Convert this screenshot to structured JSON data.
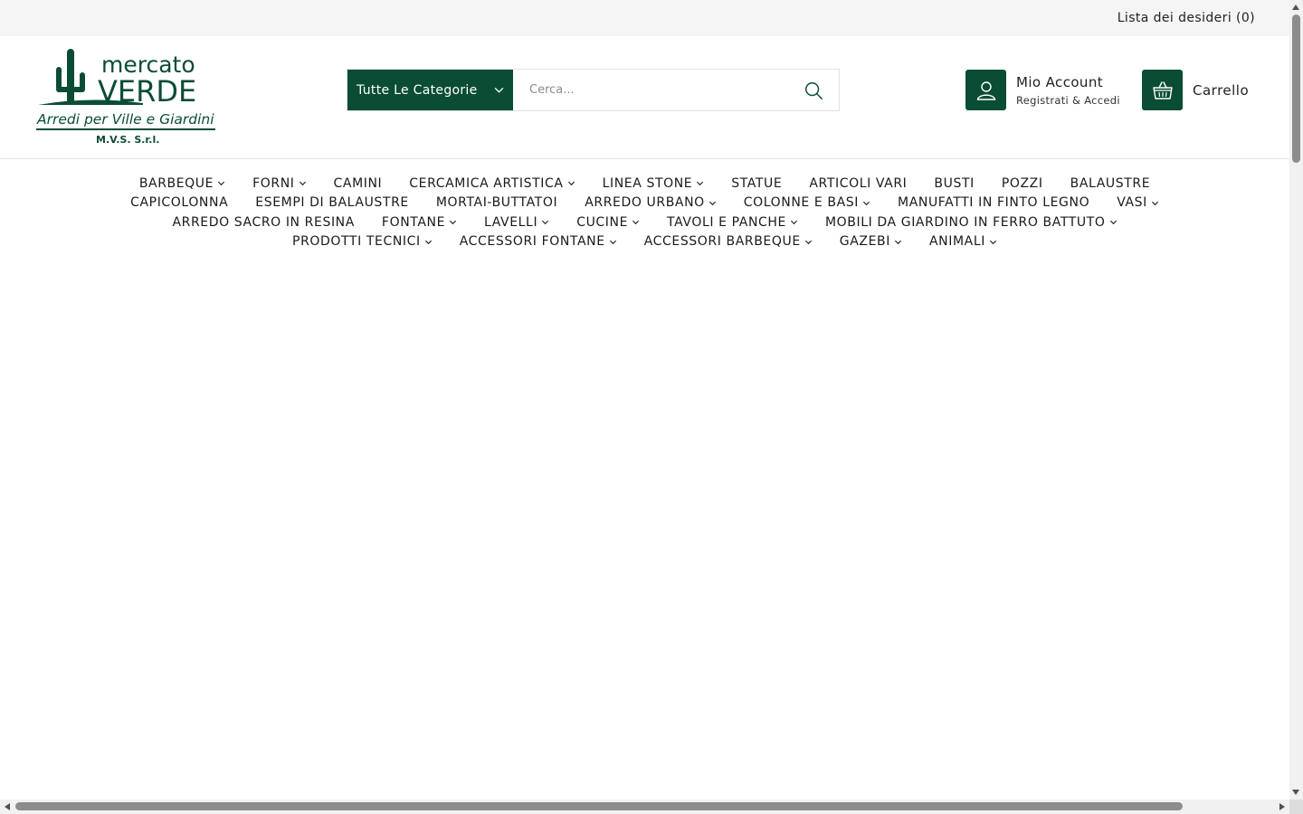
{
  "topbar": {
    "wishlist": "Lista dei desideri (0)"
  },
  "brand": {
    "logo_word1": "mercato",
    "logo_word2": "VERDE",
    "logo_tagline": "Arredi per Ville e Giardini",
    "logo_company": "M.V.S. S.r.l.",
    "color": "#0a4d34"
  },
  "search": {
    "category_label": "Tutte Le Categorie",
    "placeholder": "Cerca..."
  },
  "account": {
    "title": "Mio Account",
    "subtitle": "Registrati & Accedi"
  },
  "cart": {
    "label": "Carrello"
  },
  "nav": {
    "rows": [
      [
        {
          "label": "BARBEQUE",
          "dropdown": true
        },
        {
          "label": "FORNI",
          "dropdown": true
        },
        {
          "label": "CAMINI",
          "dropdown": false
        },
        {
          "label": "CERCAMICA ARTISTICA",
          "dropdown": true
        },
        {
          "label": "LINEA STONE",
          "dropdown": true
        },
        {
          "label": "STATUE",
          "dropdown": false
        },
        {
          "label": "ARTICOLI VARI",
          "dropdown": false
        },
        {
          "label": "BUSTI",
          "dropdown": false
        },
        {
          "label": "POZZI",
          "dropdown": false
        },
        {
          "label": "BALAUSTRE",
          "dropdown": false
        }
      ],
      [
        {
          "label": "CAPICOLONNA",
          "dropdown": false
        },
        {
          "label": "ESEMPI DI BALAUSTRE",
          "dropdown": false
        },
        {
          "label": "MORTAI-BUTTATOI",
          "dropdown": false
        },
        {
          "label": "ARREDO URBANO",
          "dropdown": true
        },
        {
          "label": "COLONNE E BASI",
          "dropdown": true
        },
        {
          "label": "MANUFATTI IN FINTO LEGNO",
          "dropdown": false
        },
        {
          "label": "VASI",
          "dropdown": true
        }
      ],
      [
        {
          "label": "ARREDO SACRO IN RESINA",
          "dropdown": false
        },
        {
          "label": "FONTANE",
          "dropdown": true
        },
        {
          "label": "LAVELLI",
          "dropdown": true
        },
        {
          "label": "CUCINE",
          "dropdown": true
        },
        {
          "label": "TAVOLI E PANCHE",
          "dropdown": true
        },
        {
          "label": "MOBILI DA GIARDINO IN FERRO BATTUTO",
          "dropdown": true
        }
      ],
      [
        {
          "label": "PRODOTTI TECNICI",
          "dropdown": true
        },
        {
          "label": "ACCESSORI FONTANE",
          "dropdown": true
        },
        {
          "label": "ACCESSORI BARBEQUE",
          "dropdown": true
        },
        {
          "label": "GAZEBI",
          "dropdown": true
        },
        {
          "label": "ANIMALI",
          "dropdown": true
        }
      ]
    ]
  }
}
